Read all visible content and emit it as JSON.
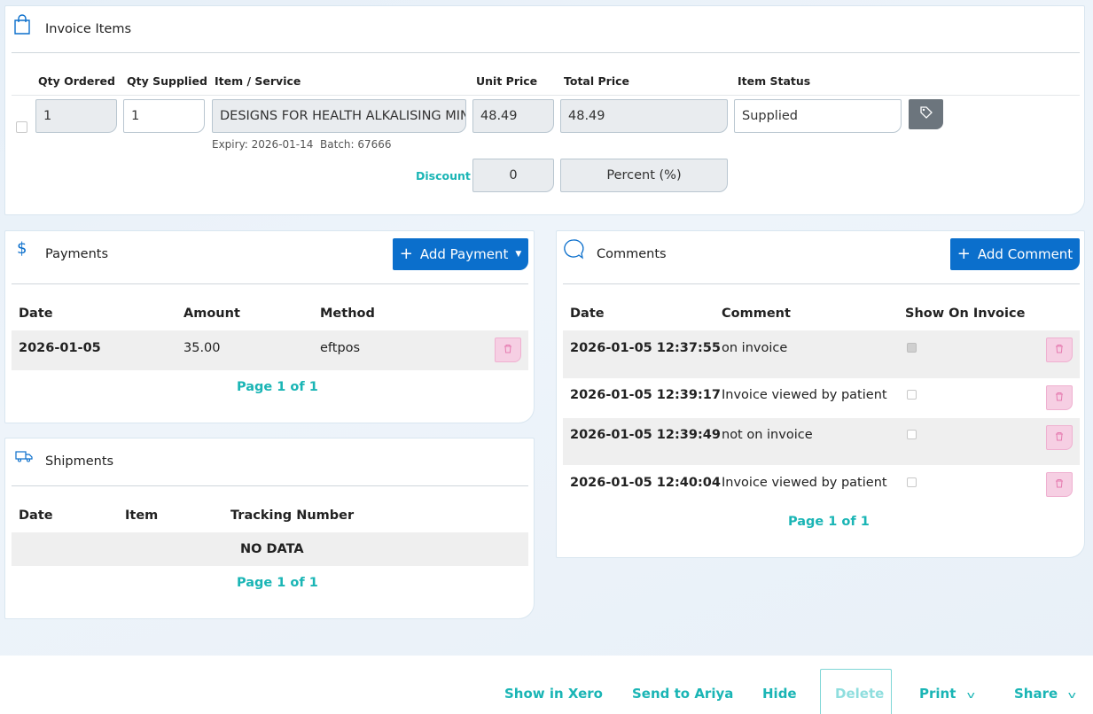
{
  "invoice_items": {
    "title": "Invoice Items",
    "headers": {
      "qty_ordered": "Qty Ordered",
      "qty_supplied": "Qty Supplied",
      "item_service": "Item / Service",
      "unit_price": "Unit Price",
      "total_price": "Total Price",
      "item_status": "Item Status"
    },
    "item": {
      "qty_ordered": "1",
      "qty_supplied": "1",
      "item_service": "DESIGNS FOR HEALTH ALKALISING MINERAL",
      "unit_price": "48.49",
      "total_price": "48.49",
      "item_status": "Supplied",
      "meta": "Expiry: 2026-01-14  Batch: 67666"
    },
    "discount": {
      "label": "Discount",
      "value": "0",
      "type": "Percent (%)"
    }
  },
  "payments": {
    "title": "Payments",
    "add_button": "Add Payment",
    "headers": {
      "date": "Date",
      "amount": "Amount",
      "method": "Method"
    },
    "rows": [
      {
        "date": "2026-01-05",
        "amount": "35.00",
        "method": "eftpos"
      }
    ],
    "pager": "Page 1 of 1"
  },
  "shipments": {
    "title": "Shipments",
    "headers": {
      "date": "Date",
      "item": "Item",
      "tracking": "Tracking Number"
    },
    "empty": "NO DATA",
    "pager": "Page 1 of 1"
  },
  "comments": {
    "title": "Comments",
    "add_button": "Add Comment",
    "headers": {
      "date": "Date",
      "comment": "Comment",
      "show_on_invoice": "Show On Invoice"
    },
    "rows": [
      {
        "date": "2026-01-05 12:37:55",
        "comment": "on invoice",
        "show": true
      },
      {
        "date": "2026-01-05 12:39:17",
        "comment": "Invoice viewed by patient",
        "show": false
      },
      {
        "date": "2026-01-05 12:39:49",
        "comment": "not on invoice",
        "show": false
      },
      {
        "date": "2026-01-05 12:40:04",
        "comment": "Invoice viewed by patient",
        "show": false
      }
    ],
    "pager": "Page 1 of 1"
  },
  "footer": {
    "show_in_xero": "Show in Xero",
    "send_to_ariya": "Send to Ariya",
    "hide": "Hide",
    "delete": "Delete",
    "print": "Print",
    "share": "Share"
  },
  "colors": {
    "accent_teal": "#1ab5b5",
    "primary_blue": "#0b6fcc",
    "delete_pink": "#f6cfe3"
  },
  "icons": {
    "invoice": "shopping-bag-icon",
    "payments": "dollar-icon",
    "shipments": "truck-icon",
    "comments": "speech-bubble-icon",
    "tag": "tag-icon",
    "trash": "trash-icon"
  }
}
